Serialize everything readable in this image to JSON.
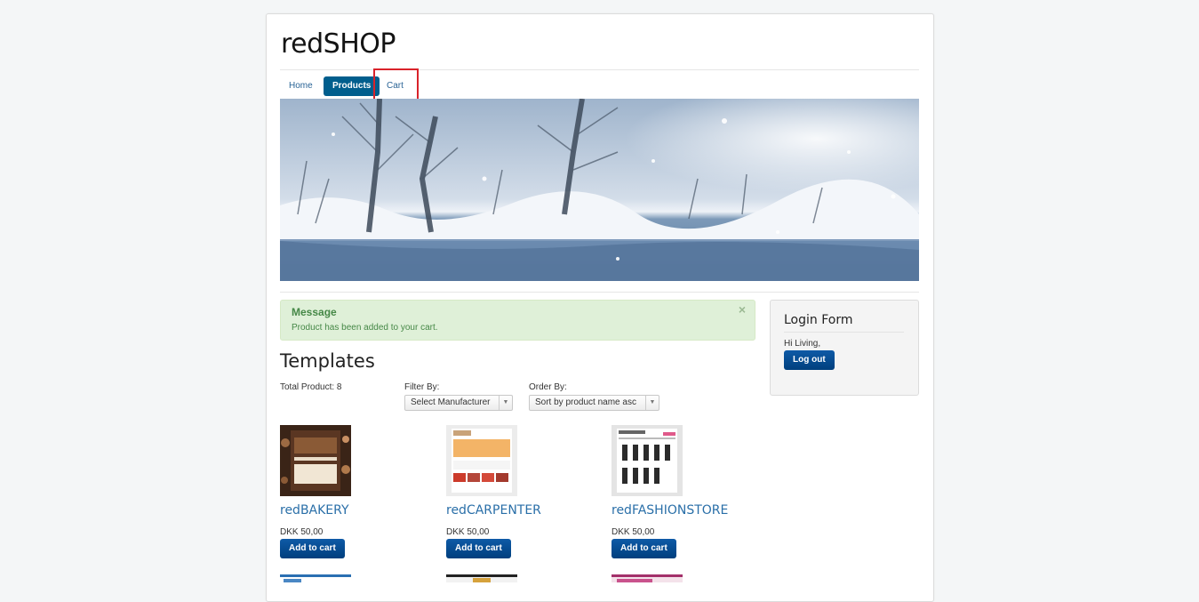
{
  "site": {
    "brand": "redSHOP"
  },
  "nav": {
    "items": [
      {
        "label": "Home",
        "active": false
      },
      {
        "label": "Products",
        "active": true
      },
      {
        "label": "Cart",
        "active": false
      }
    ]
  },
  "message": {
    "title": "Message",
    "text": "Product has been added to your cart.",
    "close": "×"
  },
  "category": {
    "title": "Templates",
    "total_label": "Total Product: 8",
    "filter_label": "Filter By:",
    "filter_value": "Select Manufacturer",
    "order_label": "Order By:",
    "order_value": "Sort by product name asc"
  },
  "products": [
    {
      "name": "redBAKERY",
      "price": "DKK 50,00",
      "button": "Add to cart"
    },
    {
      "name": "redCARPENTER",
      "price": "DKK 50,00",
      "button": "Add to cart"
    },
    {
      "name": "redFASHIONSTORE",
      "price": "DKK 50,00",
      "button": "Add to cart"
    }
  ],
  "login": {
    "title": "Login Form",
    "greeting": "Hi Living,",
    "logout": "Log out"
  },
  "colors": {
    "nav_active": "#005e8d",
    "button": "#004e8c",
    "link": "#2a6fa8",
    "success_bg": "#dff0d8",
    "highlight": "#d9232a"
  }
}
